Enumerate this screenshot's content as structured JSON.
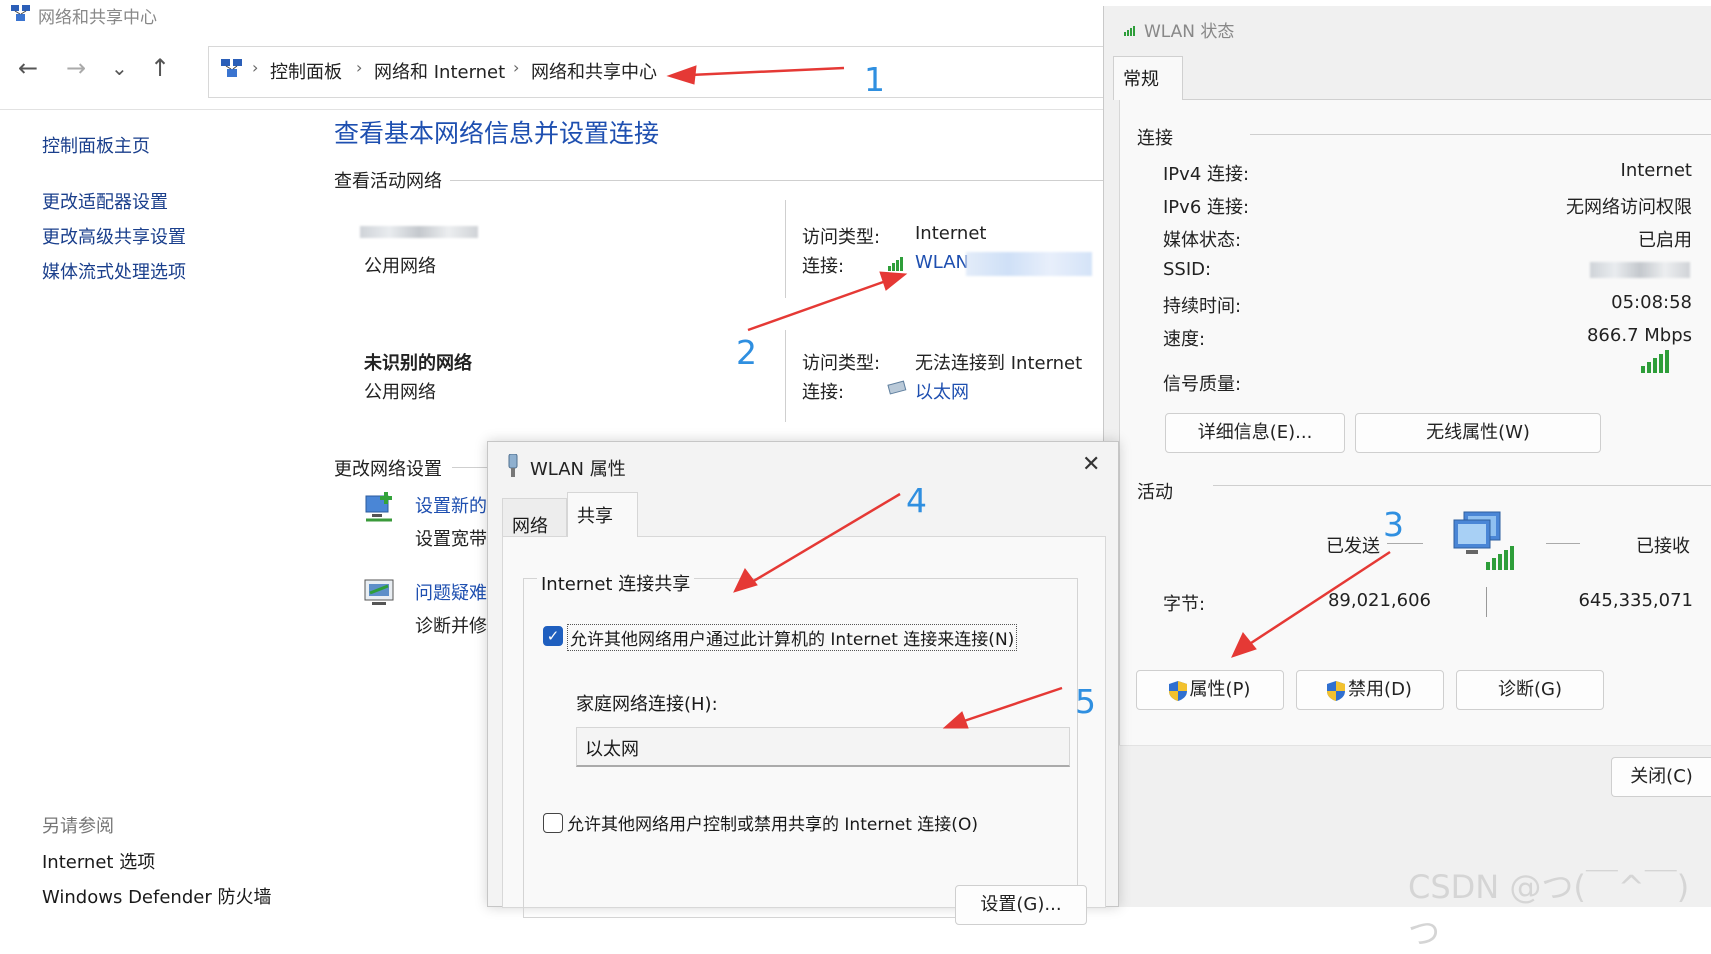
{
  "main_window": {
    "title": "网络和共享中心",
    "breadcrumb": [
      "控制面板",
      "网络和 Internet",
      "网络和共享中心"
    ],
    "nav": {
      "back": "←",
      "forward": "→",
      "recent": "⌄",
      "up": "↑"
    },
    "sidebar": {
      "home": "控制面板主页",
      "items": [
        "更改适配器设置",
        "更改高级共享设置",
        "媒体流式处理选项"
      ],
      "see_also_label": "另请参阅",
      "see_also": [
        "Internet 选项",
        "Windows Defender 防火墙"
      ]
    },
    "heading": "查看基本网络信息并设置连接",
    "active_networks_label": "查看活动网络",
    "networks": [
      {
        "name": "",
        "type": "公用网络",
        "access_label": "访问类型:",
        "access": "Internet",
        "conn_label": "连接:",
        "conn": "WLAN"
      },
      {
        "name": "未识别的网络",
        "type": "公用网络",
        "access_label": "访问类型:",
        "access": "无法连接到 Internet",
        "conn_label": "连接:",
        "conn": "以太网"
      }
    ],
    "change_settings_label": "更改网络设置",
    "tasks": [
      {
        "link": "设置新的",
        "desc": "设置宽带"
      },
      {
        "link": "问题疑难",
        "desc": "诊断并修"
      }
    ]
  },
  "status_window": {
    "title": "WLAN 状态",
    "tab": "常规",
    "connection_label": "连接",
    "rows": [
      {
        "label": "IPv4 连接:",
        "value": "Internet"
      },
      {
        "label": "IPv6 连接:",
        "value": "无网络访问权限"
      },
      {
        "label": "媒体状态:",
        "value": "已启用"
      },
      {
        "label": "SSID:",
        "value": ""
      },
      {
        "label": "持续时间:",
        "value": "05:08:58"
      },
      {
        "label": "速度:",
        "value": "866.7 Mbps"
      }
    ],
    "signal_label": "信号质量:",
    "details_button": "详细信息(E)...",
    "wireless_button": "无线属性(W)",
    "activity_label": "活动",
    "sent_label": "已发送",
    "received_label": "已接收",
    "bytes_label": "字节:",
    "bytes_sent": "89,021,606",
    "bytes_received": "645,335,071",
    "properties_button": "属性(P)",
    "disable_button": "禁用(D)",
    "diagnose_button": "诊断(G)",
    "close_button": "关闭(C)"
  },
  "properties_dialog": {
    "title": "WLAN 属性",
    "close": "✕",
    "tabs": [
      "网络",
      "共享"
    ],
    "group_label": "Internet 连接共享",
    "allow_connect": "允许其他网络用户通过此计算机的 Internet 连接来连接(N)",
    "allow_connect_checked": true,
    "home_conn_label": "家庭网络连接(H):",
    "home_conn_value": "以太网",
    "allow_control": "允许其他网络用户控制或禁用共享的 Internet 连接(O)",
    "allow_control_checked": false,
    "settings_button": "设置(G)..."
  },
  "annotations": [
    "1",
    "2",
    "3",
    "4",
    "5"
  ],
  "watermark": "CSDN @つ(￣^￣)つ",
  "colors": {
    "link": "#1e4fb0",
    "annotation": "#2f8fe0",
    "arrow": "#e53935",
    "check": "#1f5fbf"
  }
}
